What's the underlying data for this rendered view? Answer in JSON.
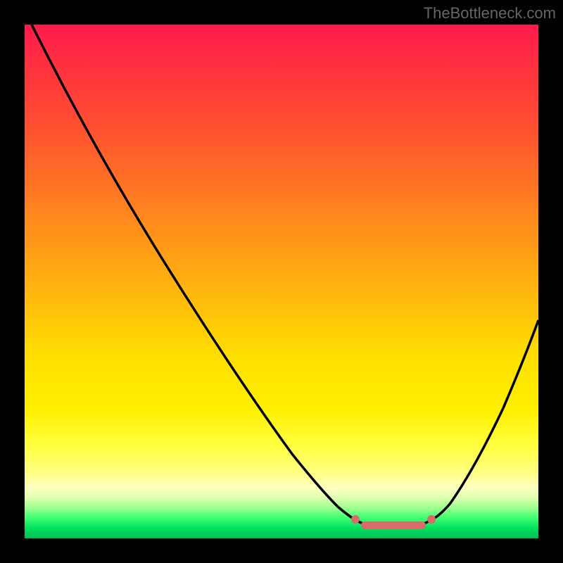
{
  "watermark": "TheBottleneck.com",
  "chart_data": {
    "type": "line",
    "title": "",
    "xlabel": "",
    "ylabel": "",
    "xlim": [
      0,
      100
    ],
    "ylim": [
      0,
      100
    ],
    "series": [
      {
        "name": "bottleneck-curve",
        "x": [
          0,
          10,
          20,
          30,
          40,
          50,
          55,
          60,
          65,
          70,
          75,
          80,
          85,
          90,
          95,
          100
        ],
        "y": [
          100,
          85,
          70,
          55,
          40,
          25,
          15,
          8,
          3,
          2,
          2,
          3,
          10,
          25,
          40,
          55
        ]
      }
    ],
    "highlight": {
      "name": "optimal-range",
      "x_start": 60,
      "x_end": 80,
      "color": "#d96b6b"
    },
    "gradient_stops": [
      {
        "pos": 0,
        "color": "#ff1a4d"
      },
      {
        "pos": 50,
        "color": "#ffe000"
      },
      {
        "pos": 90,
        "color": "#ffffc0"
      },
      {
        "pos": 100,
        "color": "#00c050"
      }
    ]
  }
}
